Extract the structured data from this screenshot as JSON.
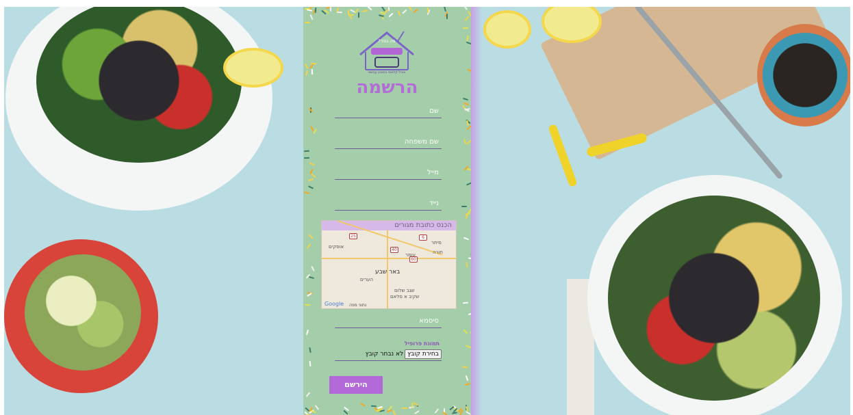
{
  "logo": {
    "alt_text": "מה בסיר?",
    "subtitle": "אוכל קלאסי בסגנון עכשווי"
  },
  "form": {
    "title": "הרשמה",
    "fields": {
      "first_name": "שם",
      "last_name": "שם משפחה",
      "email": "מייל",
      "phone": "נייד",
      "password": "סיסמא"
    },
    "address": {
      "label": "הכנס כתובת מגורים",
      "map": {
        "cities": [
          "באר שבע",
          "עומר",
          "אופקים",
          "מיתר",
          "חורה",
          "הערים",
          "שגב שלום",
          "שקיב א סלאם"
        ],
        "routes": [
          "25",
          "40",
          "6",
          "60"
        ],
        "provider": "Google",
        "footer": "נתוני מפה"
      }
    },
    "profile_picture": {
      "label": "תמונת פרופיל",
      "button": "בחירת קובץ",
      "status": "לא נבחר קובץ"
    },
    "submit": "הירשם"
  },
  "colors": {
    "panel_bg": "#a4ceaa",
    "accent_purple": "#b36ad8",
    "page_bg": "#b9dde3"
  },
  "icons": [
    "house-fork-logo-icon"
  ]
}
